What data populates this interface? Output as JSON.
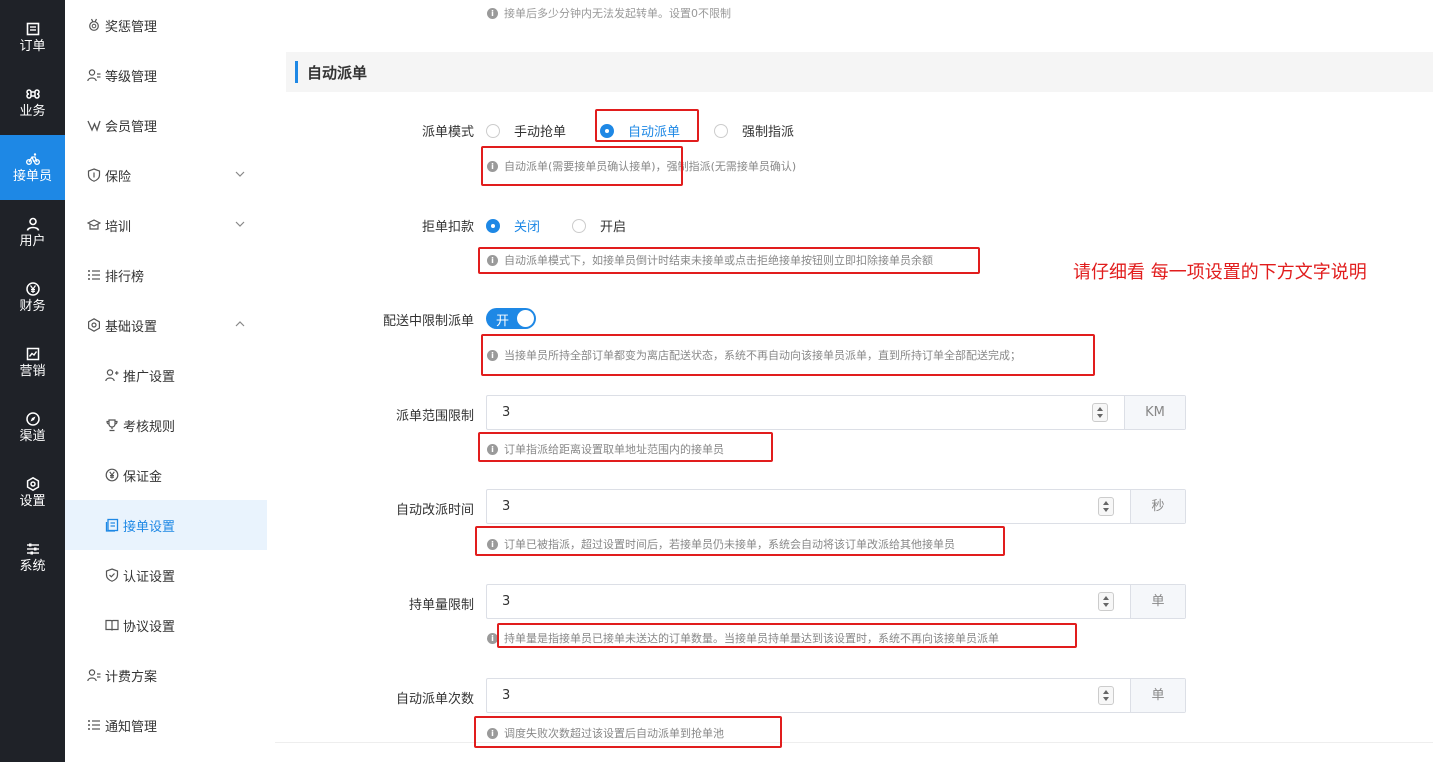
{
  "nav": {
    "items": [
      {
        "label": "订单",
        "icon": "order-icon"
      },
      {
        "label": "业务",
        "icon": "command-icon"
      },
      {
        "label": "接单员",
        "icon": "bike-icon"
      },
      {
        "label": "用户",
        "icon": "user-icon"
      },
      {
        "label": "财务",
        "icon": "yen-icon"
      },
      {
        "label": "营销",
        "icon": "chart-icon"
      },
      {
        "label": "渠道",
        "icon": "compass-icon"
      },
      {
        "label": "设置",
        "icon": "gear-icon"
      },
      {
        "label": "系统",
        "icon": "sliders-icon"
      }
    ],
    "active": "接单员"
  },
  "submenu": {
    "items": [
      {
        "label": "奖惩管理"
      },
      {
        "label": "等级管理"
      },
      {
        "label": "会员管理"
      },
      {
        "label": "保险"
      },
      {
        "label": "培训"
      },
      {
        "label": "排行榜"
      },
      {
        "label": "基础设置"
      },
      {
        "label": "推广设置"
      },
      {
        "label": "考核规则"
      },
      {
        "label": "保证金"
      },
      {
        "label": "接单设置"
      },
      {
        "label": "认证设置"
      },
      {
        "label": "协议设置"
      },
      {
        "label": "计费方案"
      },
      {
        "label": "通知管理"
      }
    ],
    "active": "接单设置"
  },
  "top_hint": "接单后多少分钟内无法发起转单。设置0不限制",
  "section": {
    "title": "自动派单"
  },
  "dispatch_mode": {
    "label": "派单模式",
    "options": [
      "手动抢单",
      "自动派单",
      "强制指派"
    ],
    "selected": "自动派单",
    "hint": "自动派单(需要接单员确认接单)，强制指派(无需接单员确认)"
  },
  "reject_deduct": {
    "label": "拒单扣款",
    "options": [
      "关闭",
      "开启"
    ],
    "selected": "关闭",
    "hint": "自动派单模式下，如接单员倒计时结束未接单或点击拒绝接单按钮则立即扣除接单员余额"
  },
  "limit_during_delivery": {
    "label": "配送中限制派单",
    "switch_text": "开",
    "on": true,
    "hint": "当接单员所持全部订单都变为离店配送状态，系统不再自动向该接单员派单，直到所持订单全部配送完成；"
  },
  "range_limit": {
    "label": "派单范围限制",
    "value": "3",
    "unit": "KM",
    "hint": "订单指派给距离设置取单地址范围内的接单员"
  },
  "auto_reassign": {
    "label": "自动改派时间",
    "value": "3",
    "unit": "秒",
    "hint": "订单已被指派，超过设置时间后，若接单员仍未接单，系统会自动将该订单改派给其他接单员"
  },
  "hold_limit": {
    "label": "持单量限制",
    "value": "3",
    "unit": "单",
    "hint": "持单量是指接单员已接单未送达的订单数量。当接单员持单量达到该设置时，系统不再向该接单员派单"
  },
  "auto_count": {
    "label": "自动派单次数",
    "value": "3",
    "unit": "单",
    "hint": "调度失败次数超过该设置后自动派单到抢单池"
  },
  "annotation": "请仔细看 每一项设置的下方文字说明",
  "colors": {
    "accent": "#1e88e5",
    "nav_bg": "#1f2228",
    "annotation_red": "#e11d1d"
  }
}
